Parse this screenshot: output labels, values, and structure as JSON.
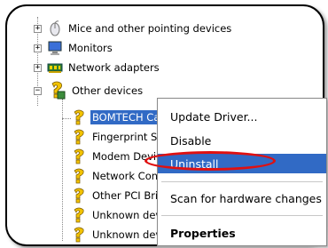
{
  "tree": {
    "categories": [
      {
        "label": "Mice and other pointing devices",
        "expander": "+",
        "icon": "mouse-icon"
      },
      {
        "label": "Monitors",
        "expander": "+",
        "icon": "monitor-icon"
      },
      {
        "label": "Network adapters",
        "expander": "+",
        "icon": "network-adapter-icon"
      },
      {
        "label": "Other devices",
        "expander": "−",
        "icon": "unknown-device-icon"
      }
    ],
    "children": [
      {
        "label": "BOMTECH Car",
        "selected": true
      },
      {
        "label": "Fingerprint Se"
      },
      {
        "label": "Modem Device"
      },
      {
        "label": "Network Cont"
      },
      {
        "label": "Other PCI Bric"
      },
      {
        "label": "Unknown devi"
      },
      {
        "label": "Unknown devi"
      }
    ]
  },
  "context_menu": {
    "items": [
      {
        "label": "Update Driver..."
      },
      {
        "label": "Disable"
      },
      {
        "label": "Uninstall",
        "highlighted": true
      },
      {
        "label": "Scan for hardware changes"
      },
      {
        "label": "Properties",
        "bold": true
      }
    ]
  },
  "colors": {
    "selection": "#316ac5",
    "annotation": "#e01010",
    "warning_icon": "#f2c200"
  }
}
